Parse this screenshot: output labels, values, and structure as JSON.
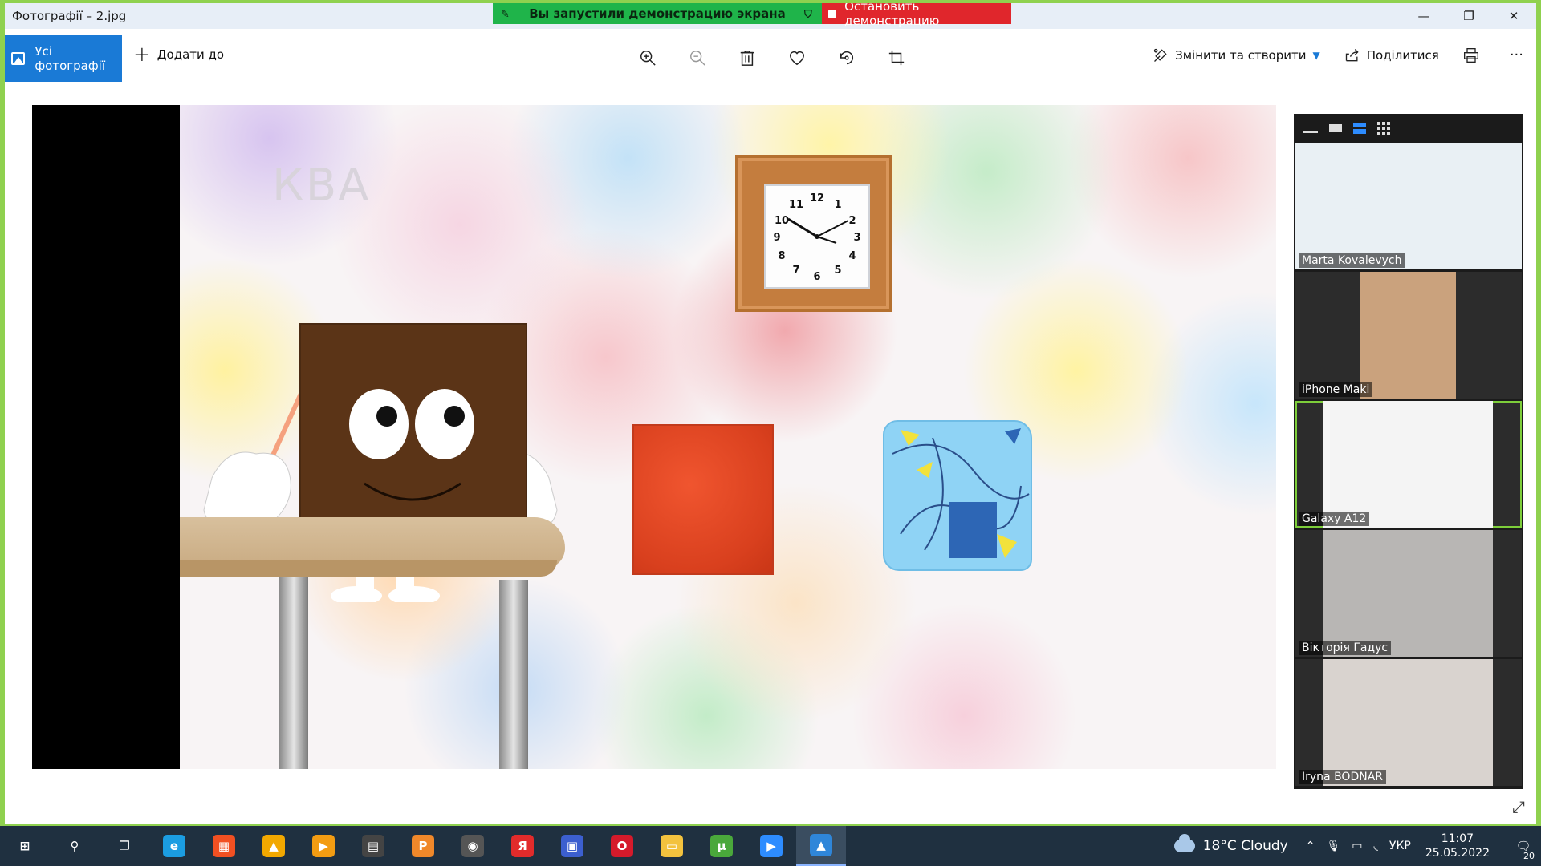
{
  "window": {
    "title": "Фотографії – 2.jpg",
    "controls": [
      "—",
      "❐",
      "✕"
    ]
  },
  "share_banner": {
    "status_text": "Вы запустили демонстрацию экрана",
    "stop_label": "Остановить демонстрацию"
  },
  "toolbar": {
    "all_photos_label": "Усі фотографії",
    "add_to_label": "Додати до",
    "edit_create_label": "Змінити та створити",
    "share_label": "Поділитися",
    "more_label": "···",
    "center_icons": [
      "zoom-in-icon",
      "zoom-out-icon",
      "delete-icon",
      "heart-icon",
      "rotate-icon",
      "crop-icon"
    ]
  },
  "slide": {
    "word": "КВА"
  },
  "gallery": {
    "participants": [
      {
        "name": "Marta Kovalevych",
        "bg": "#e9f0f4",
        "active": false
      },
      {
        "name": "iPhone Maki",
        "bg": "#caa27d",
        "active": false
      },
      {
        "name": "Galaxy A12",
        "bg": "#f4f4f4",
        "active": true
      },
      {
        "name": "Вікторія Гадус",
        "bg": "#b8b6b4",
        "active": false
      },
      {
        "name": "Iryna BODNAR",
        "bg": "#d9d3cf",
        "active": false
      }
    ]
  },
  "taskbar": {
    "weather": "18°C  Cloudy",
    "language": "УКР",
    "time": "11:07",
    "date": "25.05.2022",
    "notifications": "20",
    "apps": [
      {
        "name": "start",
        "glyph": "⊞",
        "color": "transparent"
      },
      {
        "name": "search",
        "glyph": "⚲",
        "color": "transparent"
      },
      {
        "name": "task-view",
        "glyph": "❐",
        "color": "transparent"
      },
      {
        "name": "edge",
        "glyph": "e",
        "color": "#1b9de2"
      },
      {
        "name": "store",
        "glyph": "▦",
        "color": "#f25022"
      },
      {
        "name": "app-triangle",
        "glyph": "▲",
        "color": "#f2a800"
      },
      {
        "name": "media-player",
        "glyph": "▶",
        "color": "#f39c12"
      },
      {
        "name": "video-editor",
        "glyph": "▤",
        "color": "#444444"
      },
      {
        "name": "pdf-app",
        "glyph": "P",
        "color": "#f0882a"
      },
      {
        "name": "camera-app",
        "glyph": "◉",
        "color": "#555555"
      },
      {
        "name": "yandex",
        "glyph": "Я",
        "color": "#e22b2b"
      },
      {
        "name": "save-app",
        "glyph": "▣",
        "color": "#3c5fcf"
      },
      {
        "name": "opera",
        "glyph": "O",
        "color": "#d51a2b"
      },
      {
        "name": "file-explorer",
        "glyph": "▭",
        "color": "#f3c23e"
      },
      {
        "name": "utorrent",
        "glyph": "μ",
        "color": "#4aa83b"
      },
      {
        "name": "zoom",
        "glyph": "▶",
        "color": "#2d8cff"
      },
      {
        "name": "photos",
        "glyph": "▲",
        "color": "#2f86d9"
      }
    ]
  }
}
